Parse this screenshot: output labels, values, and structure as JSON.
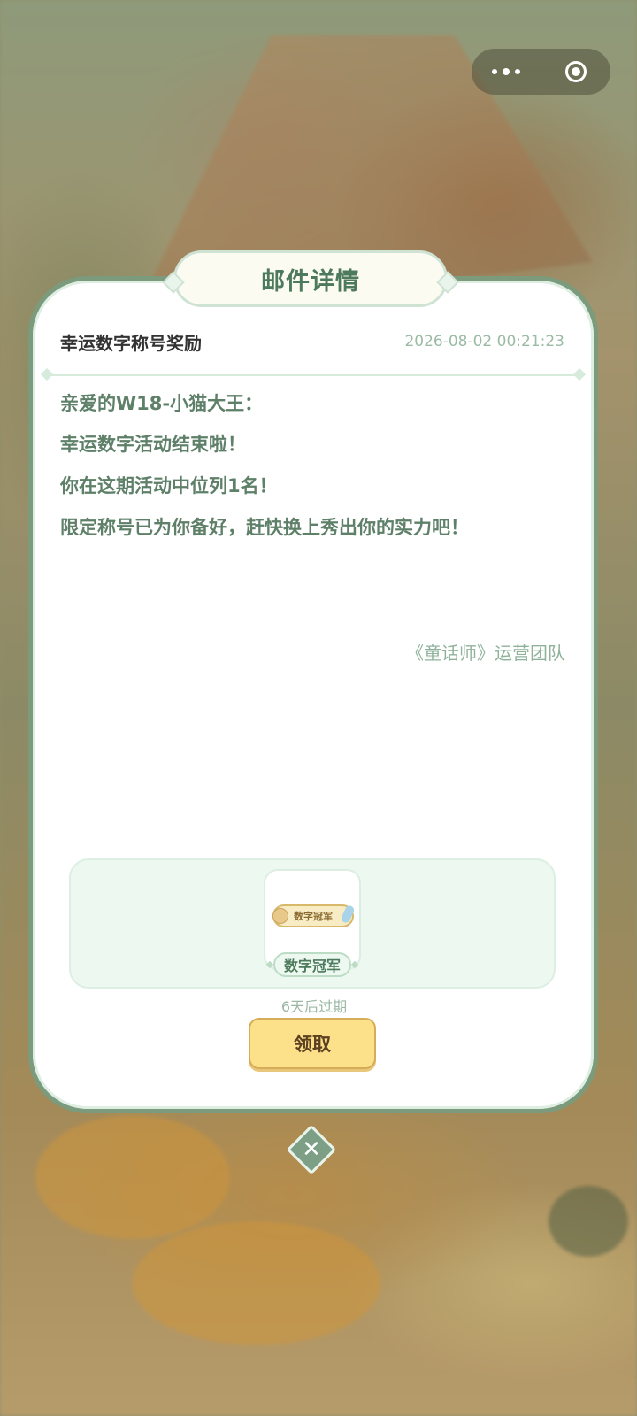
{
  "header": {
    "title": "邮件详情"
  },
  "mail": {
    "subject": "幸运数字称号奖励",
    "date": "2026-08-02 00:21:23",
    "greeting": "亲爱的W18-小猫大王：",
    "lines": [
      "幸运数字活动结束啦！",
      "你在这期活动中位列1名！",
      "限定称号已为你备好，赶快换上秀出你的实力吧！"
    ],
    "signature": "《童话师》运营团队"
  },
  "reward": {
    "badge_text": "数字冠军",
    "item_name": "数字冠军",
    "expire_text": "6天后过期"
  },
  "actions": {
    "claim_label": "领取"
  },
  "icons": {
    "more": "more-icon",
    "target": "record-icon",
    "close": "close-icon"
  },
  "colors": {
    "accent_green": "#4d7a5c",
    "claim_yellow": "#fde08a"
  }
}
